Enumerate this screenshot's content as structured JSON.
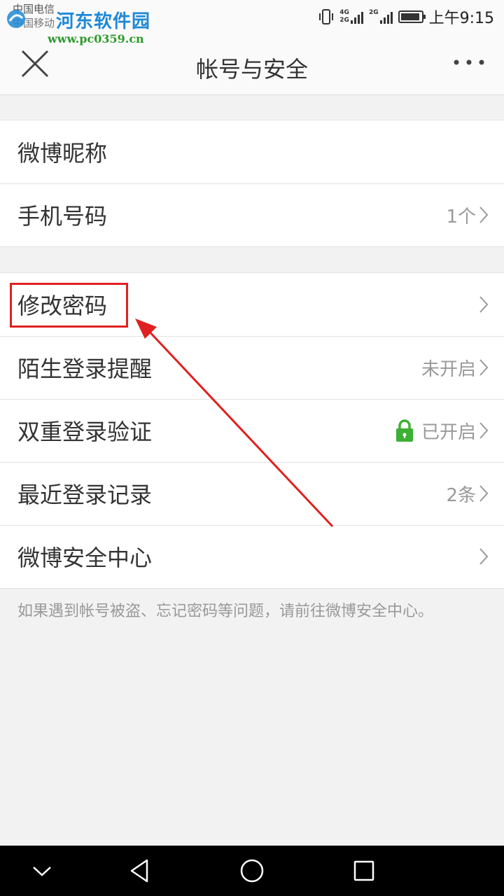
{
  "status_bar": {
    "carrier_1": "中国电信",
    "carrier_2": "中国移动",
    "network_1": "4G",
    "network_2": "2G",
    "network_3": "2G",
    "time": "上午9:15"
  },
  "watermark": {
    "title": "河东软件园",
    "url": "www.pc0359.cn"
  },
  "header": {
    "title": "帐号与安全",
    "close_icon": "close-icon",
    "more_icon": "more-icon"
  },
  "group1": {
    "items": [
      {
        "label": "微博昵称",
        "value": ""
      },
      {
        "label": "手机号码",
        "value": "1个"
      }
    ]
  },
  "group2": {
    "items": [
      {
        "label": "修改密码",
        "value": ""
      },
      {
        "label": "陌生登录提醒",
        "value": "未开启"
      },
      {
        "label": "双重登录验证",
        "value": "已开启"
      },
      {
        "label": "最近登录记录",
        "value": "2条"
      },
      {
        "label": "微博安全中心",
        "value": ""
      }
    ]
  },
  "footnote": "如果遇到帐号被盗、忘记密码等问题，请前往微博安全中心。",
  "colors": {
    "annotation": "#e02020",
    "lock": "#3cb034",
    "watermark_blue": "#1e88d6",
    "watermark_green": "#2c9a2c"
  },
  "nav": {
    "down_icon": "chevron-down-icon",
    "back_icon": "back-triangle-icon",
    "home_icon": "home-circle-icon",
    "recents_icon": "recents-square-icon"
  }
}
